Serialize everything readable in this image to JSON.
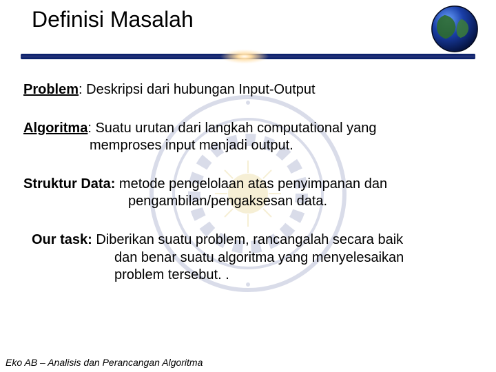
{
  "title": "Definisi Masalah",
  "defs": {
    "problem": {
      "label": "Problem",
      "sep": ":  ",
      "text": "Deskripsi dari hubungan Input-Output"
    },
    "algoritma": {
      "label": "Algoritma",
      "sep": ": ",
      "line1": "Suatu urutan dari langkah computational yang",
      "line2": "memproses input menjadi output."
    },
    "struktur": {
      "label": "Struktur Data:",
      "line1_rest": " metode pengelolaan atas penyimpanan dan",
      "line2": "pengambilan/pengaksesan data."
    },
    "task": {
      "label": "Our task:",
      "line1_rest": " Diberikan suatu problem, rancangalah secara baik",
      "line2": "dan benar suatu algoritma yang menyelesaikan",
      "line3": "problem tersebut. ."
    }
  },
  "footer": "Eko AB – Analisis dan Perancangan Algoritma",
  "icons": {
    "globe": "globe-icon",
    "watermark": "university-seal"
  }
}
